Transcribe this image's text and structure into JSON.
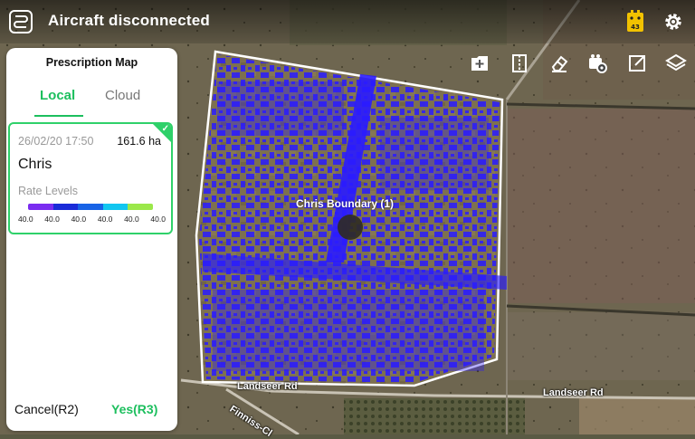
{
  "header": {
    "title": "Aircraft disconnected",
    "battery_badge": "43"
  },
  "panel": {
    "title": "Prescription Map",
    "tabs": [
      {
        "label": "Local"
      },
      {
        "label": "Cloud"
      }
    ],
    "item": {
      "date": "26/02/20 17:50",
      "area": "161.6 ha",
      "name": "Chris",
      "rate_title": "Rate Levels",
      "rate_values": [
        "40.0",
        "40.0",
        "40.0",
        "40.0",
        "40.0",
        "40.0"
      ],
      "rate_colors": [
        "#7a2cf0",
        "#1a2bd8",
        "#1863e6",
        "#12c6f0",
        "#9be84a"
      ]
    },
    "cancel_label": "Cancel(R2)",
    "confirm_label": "Yes(R3)"
  },
  "map": {
    "field_label": "Chris Boundary  (1)",
    "roads": [
      "Landseer Rd",
      "Landseer Rd",
      "Finniss-Cl"
    ],
    "prescription_color": "#2a1bff",
    "boundary_color": "#ffffff"
  },
  "colors": {
    "accent": "#1dbf5e"
  }
}
